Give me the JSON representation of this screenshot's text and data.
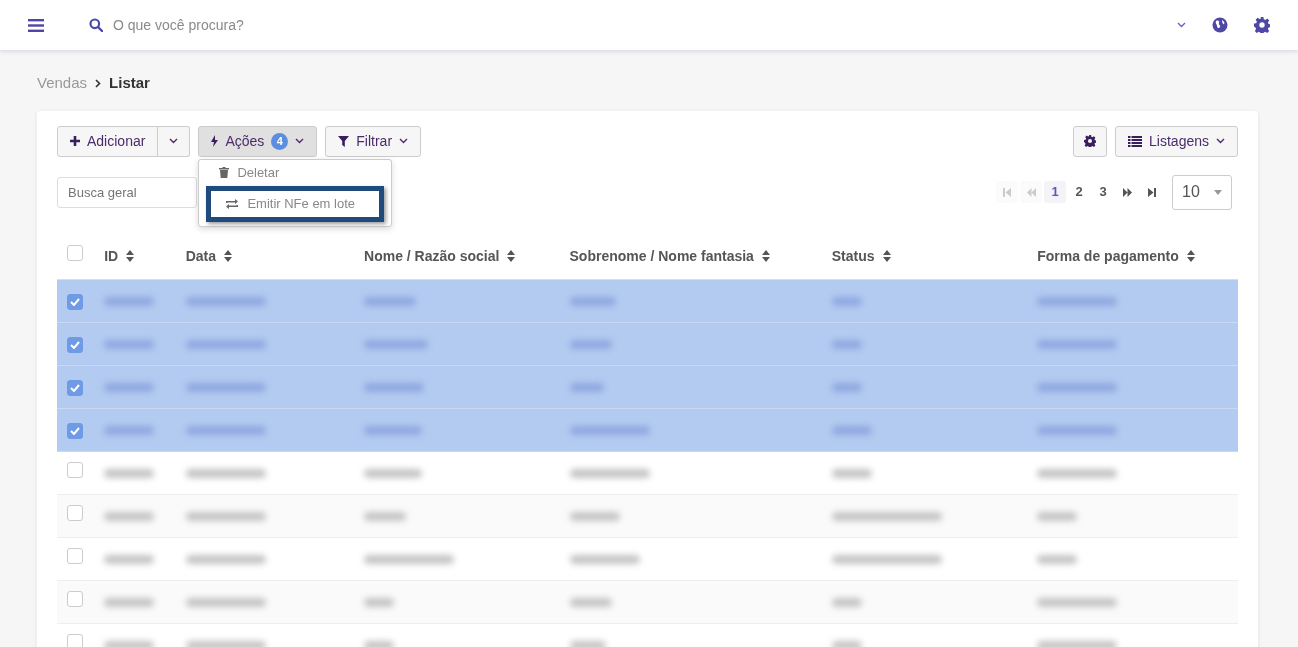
{
  "topbar": {
    "search": {
      "placeholder": "O que você procura?"
    }
  },
  "breadcrumb": [
    {
      "label": "Vendas",
      "selected": false
    },
    {
      "label": "Listar",
      "selected": true
    }
  ],
  "toolbar": {
    "add": "Adicionar",
    "actions": {
      "label": "Ações",
      "count": "4",
      "expanded": true
    },
    "filter": "Filtrar",
    "listings": "Listagens"
  },
  "actions_menu": [
    {
      "label": "Deletar",
      "kind": "delete",
      "highlighted": false
    },
    {
      "label": "Emitir NFe em lote",
      "kind": "invoice",
      "highlighted": true
    }
  ],
  "general_search": {
    "placeholder": "Busca geral"
  },
  "pagination": {
    "pages": [
      {
        "label": "1",
        "selected": true
      },
      {
        "label": "2",
        "selected": false
      },
      {
        "label": "3",
        "selected": false
      }
    ],
    "first_disabled": true,
    "prev_disabled": true,
    "page_size": "10"
  },
  "table": {
    "columns": [
      "ID",
      "Data",
      "Nome / Razão social",
      "Sobrenome / Nome fantasia",
      "Status",
      "Forma de pagamento"
    ],
    "all_checked": false,
    "rows": [
      {
        "selected": true
      },
      {
        "selected": true
      },
      {
        "selected": true
      },
      {
        "selected": true
      },
      {
        "selected": false
      },
      {
        "selected": false
      },
      {
        "selected": false
      },
      {
        "selected": false
      },
      {
        "selected": false
      }
    ]
  }
}
